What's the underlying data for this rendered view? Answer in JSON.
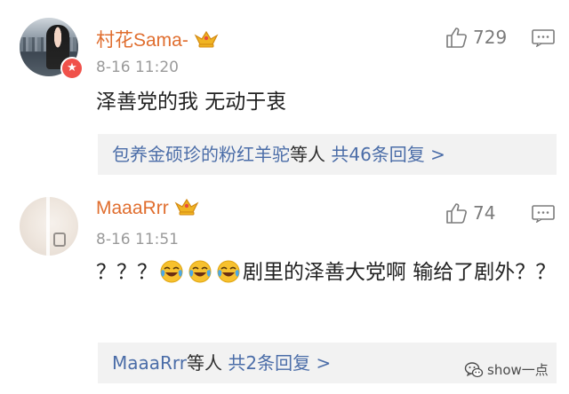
{
  "comments": [
    {
      "username": "村花Sama-",
      "timestamp": "8-16 11:20",
      "likes": "729",
      "text": "泽善党的我 无动于衷",
      "replies": {
        "link_name": "包养金硕珍的粉红羊驼",
        "plain": "等人",
        "count": "共46条回复 >"
      }
    },
    {
      "username": "MaaaRrr",
      "timestamp": "8-16 11:51",
      "likes": "74",
      "text_prefix": "？？？",
      "text_suffix": "剧里的泽善大党啊 输给了剧外？？",
      "emojis": [
        "crying-laughing-emoji",
        "crying-laughing-emoji",
        "crying-laughing-emoji"
      ],
      "replies": {
        "link_name": "MaaaRrr",
        "plain": "等人",
        "count": "共2条回复 >"
      }
    }
  ],
  "watermark": {
    "text": "show一点",
    "icon": "wechat-account-icon"
  },
  "colors": {
    "username": "#e06e2f",
    "link": "#4b6da8",
    "timestamp": "#9a9a9a",
    "reply_bg": "#f2f2f2",
    "badge": "#f0514a",
    "crown": "#f0b423"
  }
}
